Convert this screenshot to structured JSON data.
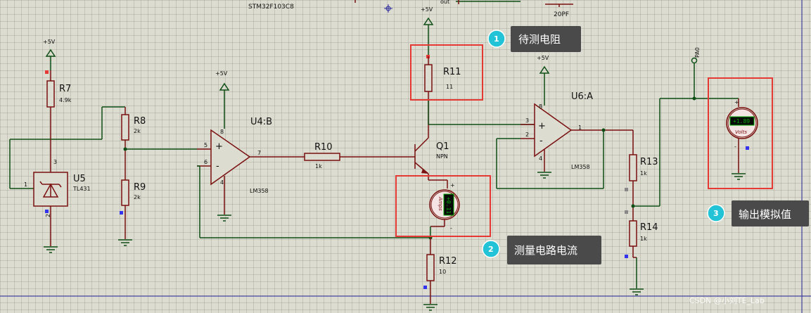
{
  "colors": {
    "wire": "#0e4f16",
    "part": "#7a1010",
    "highlight": "#e53935",
    "callout": "#4a4a4a",
    "badge": "#22c3d6",
    "background": "#dcdcd0"
  },
  "top": {
    "mcu_label": "STM32F103C8",
    "out_label": "out",
    "cap_label": "20PF"
  },
  "power": {
    "u5": "+5V",
    "u4": "+5V",
    "q1": "+5V",
    "u6": "+5V"
  },
  "pa0": "PA0",
  "parts": {
    "r7": {
      "name": "R7",
      "value": "4.9k"
    },
    "r8": {
      "name": "R8",
      "value": "2k"
    },
    "r9": {
      "name": "R9",
      "value": "2k"
    },
    "r10": {
      "name": "R10",
      "value": "1k"
    },
    "r11": {
      "name": "R11",
      "value": "11"
    },
    "r12": {
      "name": "R12",
      "value": "10"
    },
    "r13": {
      "name": "R13",
      "value": "1k"
    },
    "r14": {
      "name": "R14",
      "value": "1k"
    },
    "u5": {
      "name": "U5",
      "value": "TL431"
    },
    "u4": {
      "name": "U4:B",
      "value": "LM358"
    },
    "u6": {
      "name": "U6:A",
      "value": "LM358"
    },
    "q1": {
      "name": "Q1",
      "value": "NPN"
    }
  },
  "pins": {
    "u5_ref": "1",
    "u5_k": "3",
    "u5_a": "2",
    "u4_p": "5",
    "u4_n": "6",
    "u4_o": "7",
    "u4_v": "8",
    "u4_g": "4",
    "u6_p": "3",
    "u6_n": "2",
    "u6_o": "1",
    "u6_v": "8",
    "u6_g": "4"
  },
  "ammeter": {
    "reading": "+0.11",
    "unit": "Amps",
    "plus": "+",
    "minus": "-"
  },
  "voltmeter": {
    "reading": "+1.89",
    "unit": "Volts",
    "plus": "+",
    "minus": "-"
  },
  "callouts": [
    {
      "num": "1",
      "text": "待测电阻"
    },
    {
      "num": "2",
      "text": "测量电路电流"
    },
    {
      "num": "3",
      "text": "输出模拟值"
    }
  ],
  "watermark": "CSDN @小刘TE_Lab"
}
